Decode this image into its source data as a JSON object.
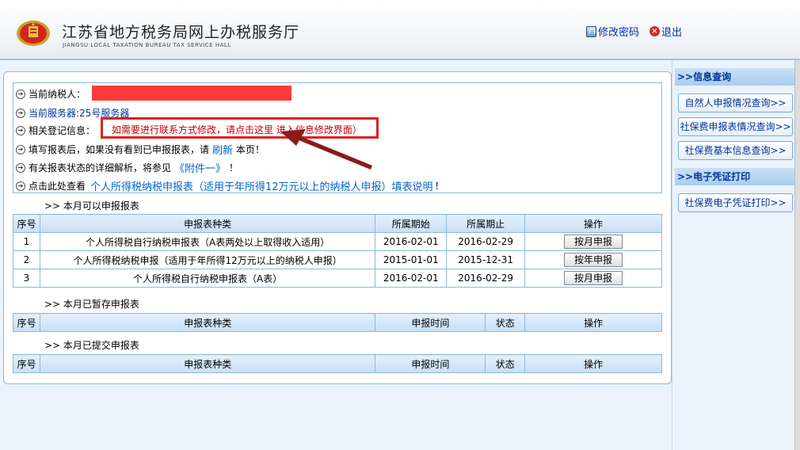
{
  "header": {
    "title_cn": "江苏省地方税务局网上办税服务厅",
    "title_en": "JIANGSU LOCAL TAXATION BUREAU TAX SERVICE HALL",
    "change_password": "修改密码",
    "logout": "退出",
    "icons": {
      "emblem": "national-emblem-icon",
      "lock": "lock-icon",
      "exit": "exit-icon"
    }
  },
  "info": {
    "taxpayer_label": "当前纳税人：",
    "server_label": "当前服务器:25号服务器",
    "reg_label": "相关登记信息：",
    "reg_notice": "如需要进行联系方式修改，请点击这里 进入信息修改界面）",
    "refresh_prefix": "填写报表后，如果没有看到已申报报表，请",
    "refresh_link": "刷新",
    "refresh_suffix": "本页！",
    "attach_prefix": "有关报表状态的详细解析，将参见",
    "attach_link": "《附件一》",
    "attach_suffix": "！",
    "guide_prefix": "点击此处查看",
    "guide_link": "个人所得税纳税申报表（适用于年所得12万元以上的纳税人申报）填表说明",
    "guide_suffix": "！"
  },
  "sections": {
    "available": ">>   本月可以申报报表",
    "saved": ">>   本月已暂存申报表",
    "submitted": ">>   本月已提交申报表"
  },
  "available_table": {
    "headers": [
      "序号",
      "申报表种类",
      "所属期始",
      "所属期止",
      "操作"
    ],
    "rows": [
      {
        "no": "1",
        "name": "个人所得税自行纳税申报表（A表两处以上取得收入适用）",
        "start": "2016-02-01",
        "end": "2016-02-29",
        "action": "按月申报"
      },
      {
        "no": "2",
        "name": "个人所得税纳税申报（适用于年所得12万元以上的纳税人申报）",
        "start": "2015-01-01",
        "end": "2015-12-31",
        "action": "按年申报"
      },
      {
        "no": "3",
        "name": "个人所得税自行纳税申报表（A表）",
        "start": "2016-02-01",
        "end": "2016-02-29",
        "action": "按月申报"
      }
    ]
  },
  "saved_table": {
    "headers": [
      "序号",
      "申报表种类",
      "申报时间",
      "状态",
      "操作"
    ]
  },
  "submitted_table": {
    "headers": [
      "序号",
      "申报表种类",
      "申报时间",
      "状态",
      "操作"
    ]
  },
  "sidebar": {
    "info_query_title": ">>信息查询",
    "info_items": [
      "自然人申报情况查询>>",
      "社保费申报表情况查询>>",
      "社保费基本信息查询>>"
    ],
    "print_title": ">>电子凭证打印",
    "print_items": [
      "社保费电子凭证打印>>"
    ]
  },
  "colors": {
    "accent_red": "#e02020",
    "link_blue": "#0066cc",
    "border_blue": "#8cb8dc"
  }
}
